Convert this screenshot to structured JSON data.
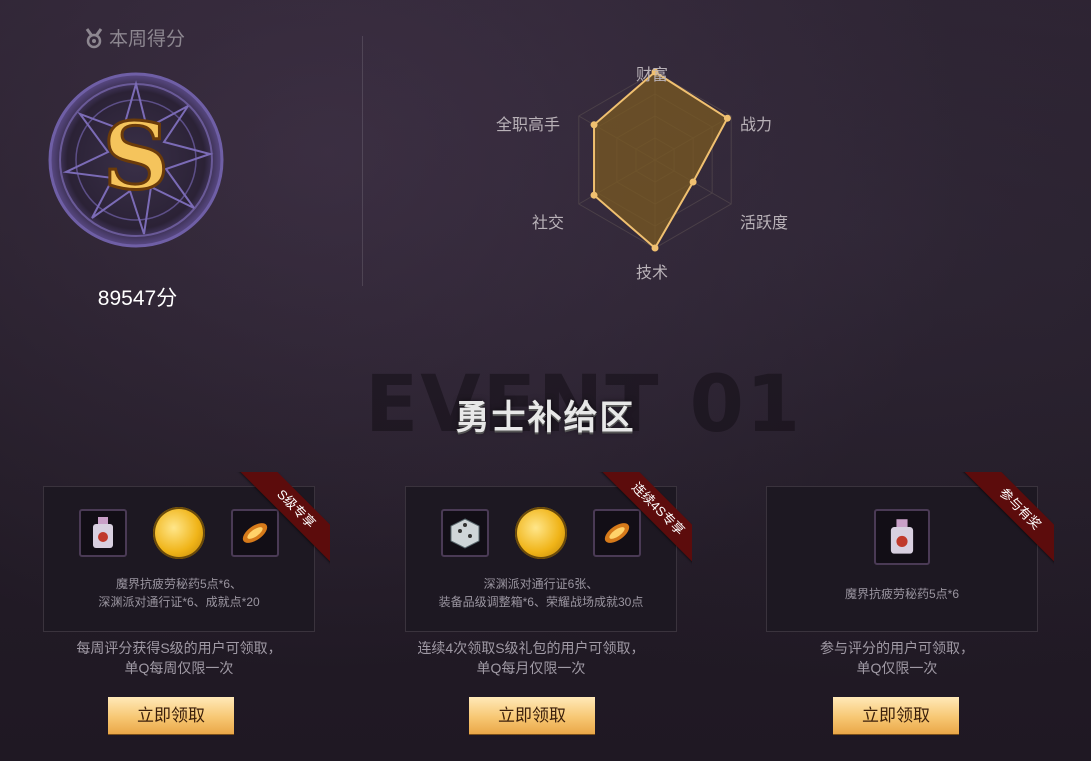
{
  "header": {
    "week_score_label": "本周得分"
  },
  "rating": {
    "grade": "S",
    "score": "89547分"
  },
  "radar": {
    "axes": [
      "财富",
      "战力",
      "活跃度",
      "技术",
      "社交",
      "全职高手"
    ],
    "values": [
      1.0,
      0.95,
      0.5,
      1.0,
      0.8,
      0.8
    ],
    "colors": {
      "fill": "#7a5a22",
      "stroke": "#f0c070",
      "grid": "#4b4048"
    }
  },
  "section": {
    "title": "勇士补给区",
    "bg_text": "EVENT 01"
  },
  "cards": [
    {
      "ribbon": "S级专享",
      "icons": [
        "potion-icon",
        "coin-icon",
        "feather-icon"
      ],
      "desc_line1": "魔界抗疲劳秘药5点*6、",
      "desc_line2": "深渊派对通行证*6、成就点*20",
      "note_line1": "每周评分获得S级的用户可领取，",
      "note_line2": "单Q每周仅限一次",
      "button": "立即领取"
    },
    {
      "ribbon": "连续4S专享",
      "icons": [
        "dice-box-icon",
        "coin-icon",
        "feather-icon"
      ],
      "desc_line1": "深渊派对通行证6张、",
      "desc_line2": "装备品级调整箱*6、荣耀战场成就30点",
      "note_line1": "连续4次领取S级礼包的用户可领取，",
      "note_line2": "单Q每月仅限一次",
      "button": "立即领取"
    },
    {
      "ribbon": "参与有奖",
      "icons": [
        "potion-icon"
      ],
      "desc_line1": "魔界抗疲劳秘药5点*6",
      "desc_line2": "",
      "note_line1": "参与评分的用户可领取，",
      "note_line2": "单Q仅限一次",
      "button": "立即领取"
    }
  ]
}
